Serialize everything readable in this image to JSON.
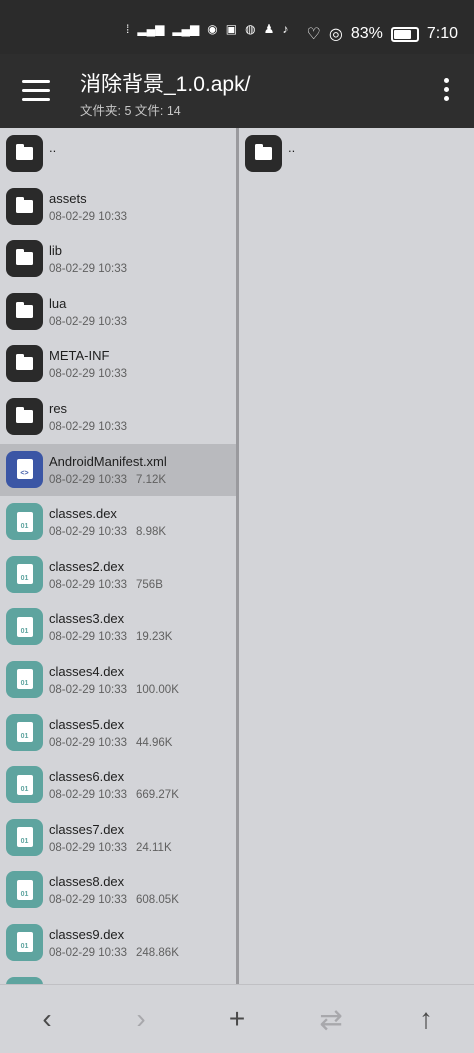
{
  "status_bar": {
    "battery_percent": "83%",
    "time": "7:10",
    "indicator_icons": [
      "network-icon",
      "signal-icon",
      "signal-icon",
      "hotspot-icon",
      "gallery-icon",
      "browser-icon",
      "qq-icon",
      "tiktok-icon",
      "heart-icon",
      "vpn-icon"
    ]
  },
  "app_bar": {
    "title": "消除背景_1.0.apk/",
    "subtitle": "文件夹: 5  文件: 14"
  },
  "left_pane": {
    "rows": [
      {
        "type": "folder",
        "name": "..",
        "date": "",
        "size": ""
      },
      {
        "type": "folder",
        "name": "assets",
        "date": "08-02-29 10:33",
        "size": ""
      },
      {
        "type": "folder",
        "name": "lib",
        "date": "08-02-29 10:33",
        "size": ""
      },
      {
        "type": "folder",
        "name": "lua",
        "date": "08-02-29 10:33",
        "size": ""
      },
      {
        "type": "folder",
        "name": "META-INF",
        "date": "08-02-29 10:33",
        "size": ""
      },
      {
        "type": "folder",
        "name": "res",
        "date": "08-02-29 10:33",
        "size": ""
      },
      {
        "type": "xml",
        "name": "AndroidManifest.xml",
        "date": "08-02-29 10:33",
        "size": "7.12K",
        "selected": true
      },
      {
        "type": "dex",
        "name": "classes.dex",
        "date": "08-02-29 10:33",
        "size": "8.98K"
      },
      {
        "type": "dex",
        "name": "classes2.dex",
        "date": "08-02-29 10:33",
        "size": "756B"
      },
      {
        "type": "dex",
        "name": "classes3.dex",
        "date": "08-02-29 10:33",
        "size": "19.23K"
      },
      {
        "type": "dex",
        "name": "classes4.dex",
        "date": "08-02-29 10:33",
        "size": "100.00K"
      },
      {
        "type": "dex",
        "name": "classes5.dex",
        "date": "08-02-29 10:33",
        "size": "44.96K"
      },
      {
        "type": "dex",
        "name": "classes6.dex",
        "date": "08-02-29 10:33",
        "size": "669.27K"
      },
      {
        "type": "dex",
        "name": "classes7.dex",
        "date": "08-02-29 10:33",
        "size": "24.11K"
      },
      {
        "type": "dex",
        "name": "classes8.dex",
        "date": "08-02-29 10:33",
        "size": "608.05K"
      },
      {
        "type": "dex",
        "name": "classes9.dex",
        "date": "08-02-29 10:33",
        "size": "248.86K"
      },
      {
        "type": "dex",
        "name": "",
        "date": "",
        "size": ""
      }
    ],
    "dex_icon_text": "01",
    "xml_icon_text": "<>"
  },
  "right_pane": {
    "rows": [
      {
        "type": "folder",
        "name": ".."
      }
    ]
  },
  "bottom_bar": {
    "back_icon": "‹",
    "forward_icon": "›",
    "add_icon": "+",
    "swap_icon": "⇄",
    "up_icon": "↑"
  },
  "colors": {
    "status_bar": "#2b2b2b",
    "app_bar": "#2e2e2e",
    "pane_bg": "#d3d4d8",
    "selected_row": "#b9babe",
    "folder_icon": "#2a2a2a",
    "xml_icon": "#3b56a5",
    "dex_icon": "#5ea49f"
  }
}
